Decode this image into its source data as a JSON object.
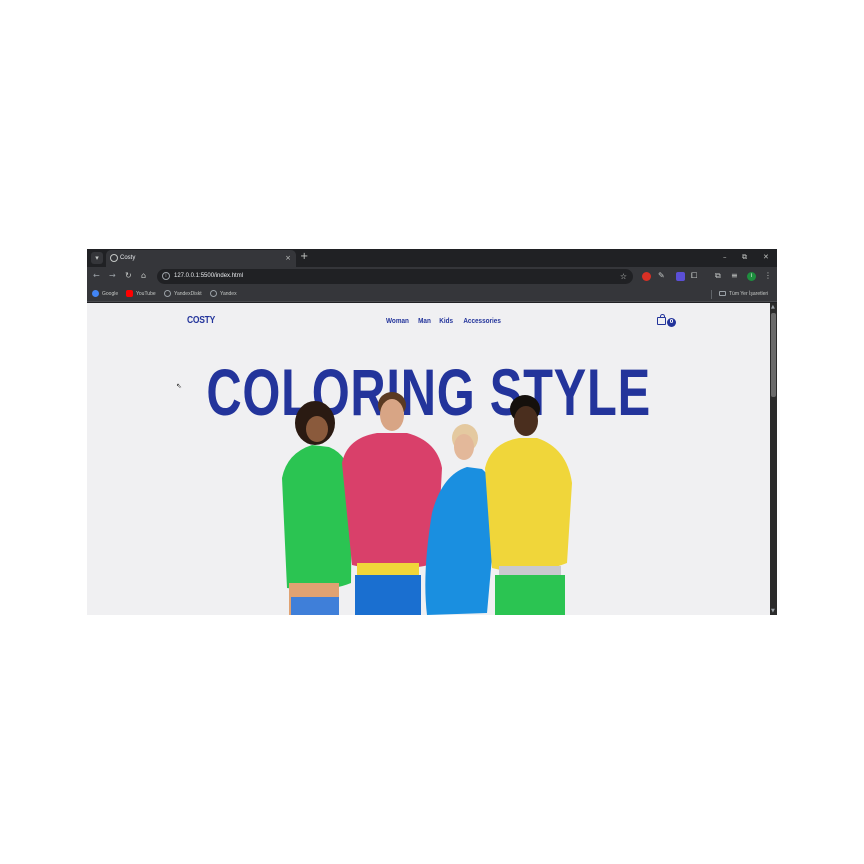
{
  "browser": {
    "tab_title": "Costy",
    "url": "127.0.0.1:5500/index.html",
    "new_tab": "+",
    "tab_close": "×",
    "window_controls": [
      "–",
      "⧉",
      "✕"
    ],
    "bookmarks": [
      {
        "label": "Google",
        "color": "#4285f4"
      },
      {
        "label": "YouTube",
        "color": "#ff0000"
      },
      {
        "label": "YandexDiskt",
        "color": "#9aa0a6"
      },
      {
        "label": "Yandex",
        "color": "#9aa0a6"
      }
    ],
    "all_bookmarks": "Tüm Yer İşaretleri",
    "profile_initial": "i",
    "icons": [
      "back-icon",
      "forward-icon",
      "reload-icon",
      "home-icon",
      "info-icon",
      "star-icon",
      "extension-icon",
      "puzzle-icon",
      "menu-icon"
    ]
  },
  "site": {
    "logo": "COSTY",
    "nav": [
      "Woman",
      "Man",
      "Kids",
      "Accessories"
    ],
    "cart_count": "0",
    "hero_title": "COLORING STYLE"
  },
  "colors": {
    "brand": "#23349b",
    "page_bg": "#f0f0f2",
    "hoodie_green": "#2bc452",
    "hoodie_pink": "#d9406a",
    "hoodie_blue": "#1a8fe0",
    "hoodie_yellow": "#f0d63a"
  }
}
